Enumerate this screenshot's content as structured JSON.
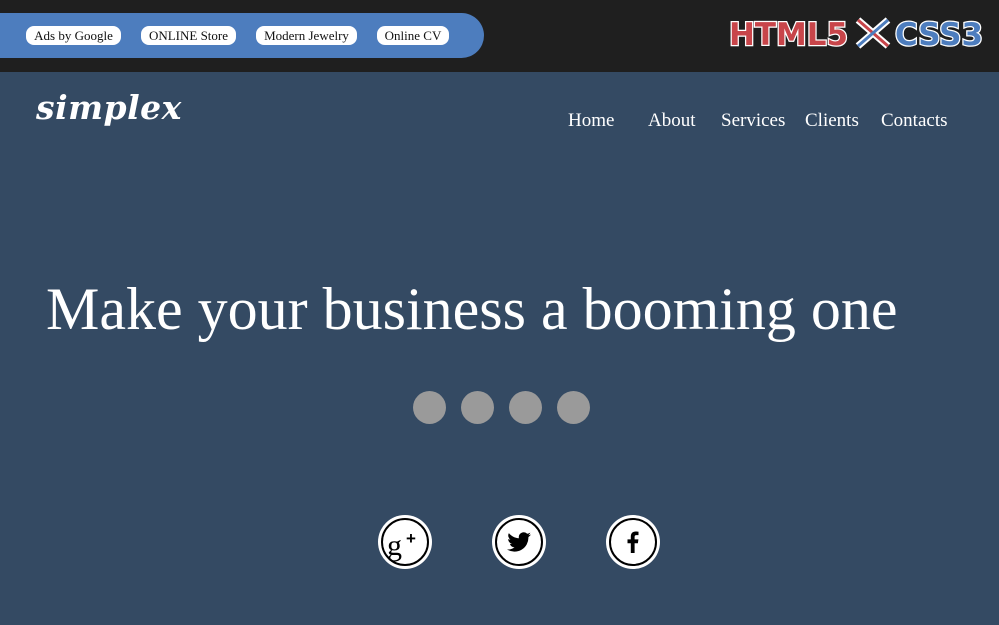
{
  "ad_bar": {
    "links": [
      {
        "label": "Ads by Google"
      },
      {
        "label": "ONLINE Store"
      },
      {
        "label": "Modern Jewelry"
      },
      {
        "label": "Online CV"
      }
    ],
    "badge": {
      "left_text": "HTML5",
      "right_text": "CSS3",
      "left_color": "#c8454a",
      "right_color": "#4d7dbe"
    }
  },
  "header": {
    "logo": "simplex",
    "nav": [
      {
        "label": "Home"
      },
      {
        "label": "About"
      },
      {
        "label": "Services"
      },
      {
        "label": "Clients"
      },
      {
        "label": "Contacts"
      }
    ]
  },
  "hero": {
    "headline": "Make your business a booming one",
    "slider_dots": 4
  },
  "social": [
    {
      "icon": "google-plus-icon"
    },
    {
      "icon": "twitter-icon"
    },
    {
      "icon": "facebook-icon"
    }
  ],
  "colors": {
    "background": "#344a63",
    "topbar": "#1f1f1f",
    "ad_pill": "#4d7dbe",
    "dot": "#9a9a9a"
  }
}
